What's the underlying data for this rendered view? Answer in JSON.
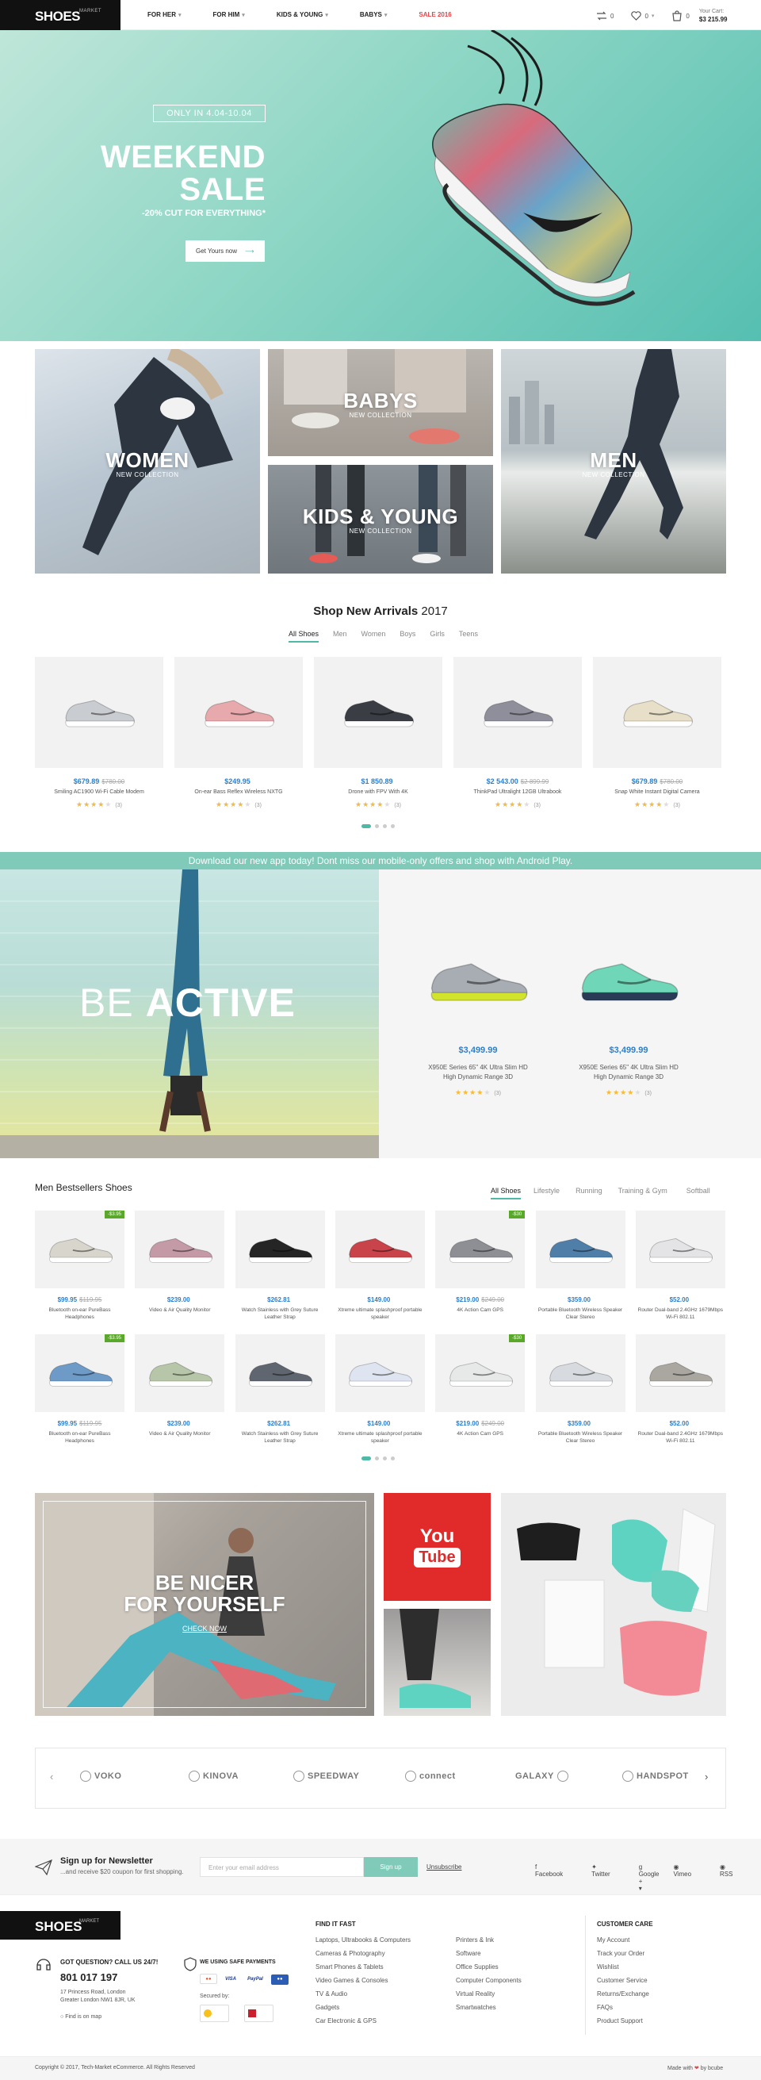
{
  "header": {
    "logo": "SHOES",
    "logo_tag": "MARKET",
    "nav": [
      {
        "label": "FOR HER",
        "chevron": "chevron-down-icon"
      },
      {
        "label": "FOR HIM",
        "chevron": "chevron-down-icon"
      },
      {
        "label": "KIDS & YOUNG",
        "chevron": "chevron-down-icon"
      },
      {
        "label": "BABYS",
        "chevron": "chevron-down-icon"
      },
      {
        "label": "SALE 2016",
        "color": "#e8454a"
      }
    ],
    "compare_count": "0",
    "wishlist_count": "0",
    "cart_count": "0",
    "cart_label": "Your Cart:",
    "cart_total": "$3 215.99"
  },
  "hero": {
    "badge": "ONLY IN 4.04-10.04",
    "title_line1": "WEEKEND",
    "title_line2": "SALE",
    "subtitle": "-20% CUT FOR EVERYTHING*",
    "cta": "Get Yours now",
    "accent": "#4fb9a8"
  },
  "categories": [
    {
      "title": "WOMEN",
      "subtitle": "NEW COLLECTION"
    },
    {
      "title": "BABYS",
      "subtitle": "NEW COLLECTION"
    },
    {
      "title": "KIDS & YOUNG",
      "subtitle": "NEW COLLECTION"
    },
    {
      "title": "MEN",
      "subtitle": "NEW COLLECTION"
    }
  ],
  "arrivals": {
    "title": "Shop New Arrivals",
    "year": "2017",
    "tabs": [
      "All Shoes",
      "Men",
      "Women",
      "Boys",
      "Girls",
      "Teens"
    ],
    "active_tab": 0,
    "products": [
      {
        "price": "$679.89",
        "old_price": "$780.00",
        "name": "Smiling AC1900 Wi-Fi Cable Modem",
        "rating": 4,
        "reviews": "(3)",
        "color": "#c9ccd0"
      },
      {
        "price": "$249.95",
        "old_price": "",
        "name": "On-ear Bass Reflex Wireless NXTG",
        "rating": 4,
        "reviews": "(3)",
        "color": "#e8a9ad"
      },
      {
        "price": "$1 850.89",
        "old_price": "",
        "name": "Drone with FPV With 4K",
        "rating": 4,
        "reviews": "(3)",
        "color": "#3a3e44"
      },
      {
        "price": "$2 543.00",
        "old_price": "$2 899.99",
        "name": "ThinkPad Ultralight 12GB Ultrabook",
        "rating": 4,
        "reviews": "(3)",
        "color": "#8f8f9c"
      },
      {
        "price": "$679.89",
        "old_price": "$780.00",
        "name": "Snap White Instant Digital Camera",
        "rating": 4,
        "reviews": "(3)",
        "color": "#e8dfc8"
      }
    ]
  },
  "app_banner": "Download our new app today! Dont miss our mobile-only offers and shop with Android Play.",
  "be_active": {
    "title_light": "BE",
    "title_bold": "ACTIVE",
    "products": [
      {
        "price": "$3,499.99",
        "name_line1": "X950E Series 65\" 4K Ultra Slim HD",
        "name_line2": "High Dynamic Range 3D",
        "rating": 4,
        "reviews": "(3)",
        "color": "#a7adb3",
        "accent": "#d2e32b"
      },
      {
        "price": "$3,499.99",
        "name_line1": "X950E Series 65\" 4K Ultra Slim HD",
        "name_line2": "High Dynamic Range 3D",
        "rating": 4,
        "reviews": "(3)",
        "color": "#6fd7b8",
        "accent": "#2a3b57"
      }
    ]
  },
  "bestsellers": {
    "title": "Men Bestsellers Shoes",
    "tabs": [
      "All Shoes",
      "Lifestyle",
      "Running",
      "Training & Gym",
      "Softball"
    ],
    "active_tab": 0,
    "rows": [
      [
        {
          "price": "$99.95",
          "old_price": "$119.95",
          "name": "Bluetooth on-ear PureBass Headphones",
          "badge": "-$3.95",
          "color": "#d8d5cc"
        },
        {
          "price": "$239.00",
          "old_price": "",
          "name": "Video & Air Quality Monitor",
          "badge": "",
          "color": "#c49aa7"
        },
        {
          "price": "$262.81",
          "old_price": "",
          "name": "Watch Stainless with Grey Suture Leather Strap",
          "badge": "",
          "color": "#252525"
        },
        {
          "price": "$149.00",
          "old_price": "",
          "name": "Xtreme ultimate splashproof portable speaker",
          "badge": "",
          "color": "#c9434a"
        },
        {
          "price": "$219.00",
          "old_price": "$249.00",
          "name": "4K Action Cam GPS",
          "badge": "-$30",
          "color": "#8d8f94"
        },
        {
          "price": "$359.00",
          "old_price": "",
          "name": "Portable Bluetooth Wireless Speaker Clear Stereo",
          "badge": "",
          "color": "#4f7ea8"
        },
        {
          "price": "$52.00",
          "old_price": "",
          "name": "Router Dual-band 2.4GHz 1679Mbps Wi-Fi 802.11",
          "badge": "",
          "color": "#e4e4e6"
        }
      ],
      [
        {
          "price": "$99.95",
          "old_price": "$119.95",
          "name": "Bluetooth on-ear PureBass Headphones",
          "badge": "-$3.95",
          "color": "#6d9ac6"
        },
        {
          "price": "$239.00",
          "old_price": "",
          "name": "Video & Air Quality Monitor",
          "badge": "",
          "color": "#b7c6a8"
        },
        {
          "price": "$262.81",
          "old_price": "",
          "name": "Watch Stainless with Grey Suture Leather Strap",
          "badge": "",
          "color": "#5f6670"
        },
        {
          "price": "$149.00",
          "old_price": "",
          "name": "Xtreme ultimate splashproof portable speaker",
          "badge": "",
          "color": "#dfe4f1"
        },
        {
          "price": "$219.00",
          "old_price": "$249.00",
          "name": "4K Action Cam GPS",
          "badge": "-$30",
          "color": "#e7e9e9"
        },
        {
          "price": "$359.00",
          "old_price": "",
          "name": "Portable Bluetooth Wireless Speaker Clear Stereo",
          "badge": "",
          "color": "#d7dbe0"
        },
        {
          "price": "$52.00",
          "old_price": "",
          "name": "Router Dual-band 2.4GHz 1679Mbps Wi-Fi 802.11",
          "badge": "",
          "color": "#a9a79f"
        }
      ]
    ]
  },
  "promo": {
    "title_line1": "BE NICER",
    "title_line2": "FOR YOURSELF",
    "link": "CHECK NOW",
    "youtube_top": "You",
    "youtube_bottom": "Tube",
    "youtube_color": "#e12b2b"
  },
  "brands": [
    "VOKO",
    "KINOVA",
    "SPEEDWAY",
    "connect",
    "GALAXY",
    "HANDSPOT"
  ],
  "newsletter": {
    "title": "Sign up for Newsletter",
    "subtitle": "...and receive $20 coupon for first shopping.",
    "placeholder": "Enter your email address",
    "button": "Sign up",
    "unsubscribe": "Unsubscribe",
    "social": [
      "Facebook",
      "Twitter",
      "Google +",
      "Vimeo",
      "RSS"
    ]
  },
  "footer": {
    "logo": "SHOES",
    "logo_tag": "MARKET",
    "question": "GOT QUESTION? CALL US 24/7!",
    "phone": "801 017 197",
    "address_line1": "17 Princess Road, London",
    "address_line2": "Greater London NW1 8JR, UK",
    "map_link": "Find is on map",
    "payment_title": "WE USING SAFE PAYMENTS",
    "secured_by": "Secured by:",
    "find_title": "FIND IT FAST",
    "find_col1": [
      "Laptops, Ultrabooks & Computers",
      "Cameras & Photography",
      "Smart Phones & Tablets",
      "Video Games & Consoles",
      "TV & Audio",
      "Gadgets",
      "Car Electronic & GPS"
    ],
    "find_col2": [
      "Printers & Ink",
      "Software",
      "Office Supplies",
      "Computer Components",
      "Virtual Reality",
      "Smartwatches"
    ],
    "care_title": "CUSTOMER CARE",
    "care_links": [
      "My Account",
      "Track your Order",
      "Wishlist",
      "Customer Service",
      "Returns/Exchange",
      "FAQs",
      "Product Support"
    ],
    "copyright": "Copyright © 2017, Tech-Market eCommerce. All Rights Reserved",
    "made_with": "Made with",
    "made_by": "by bcube"
  }
}
